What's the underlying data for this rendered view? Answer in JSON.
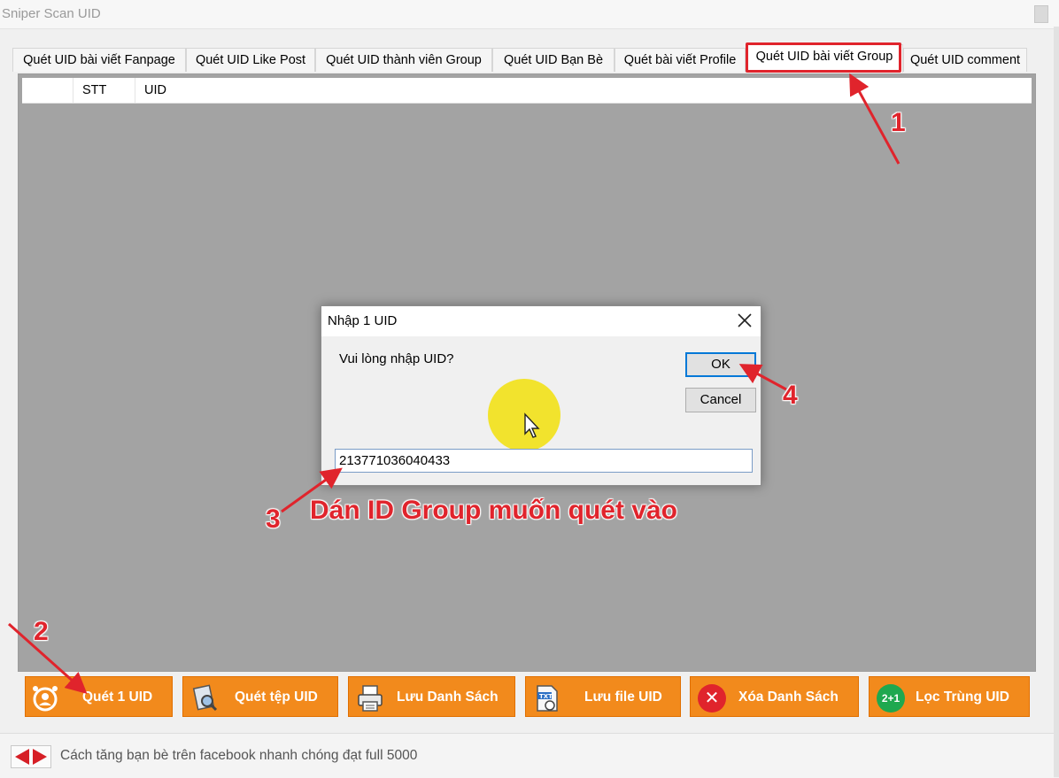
{
  "window": {
    "title": "Sniper Scan UID"
  },
  "tabs": [
    {
      "label": "Quét UID bài viết Fanpage",
      "active": false
    },
    {
      "label": "Quét UID Like Post",
      "active": false
    },
    {
      "label": "Quét UID thành viên Group",
      "active": false
    },
    {
      "label": "Quét UID Bạn Bè",
      "active": false
    },
    {
      "label": "Quét bài viết Profile",
      "active": false
    },
    {
      "label": "Quét UID bài viết Group",
      "active": true
    },
    {
      "label": "Quét UID comment",
      "active": false
    }
  ],
  "list": {
    "columns": [
      "",
      "STT",
      "UID"
    ]
  },
  "toolbar": [
    {
      "label": "Quét 1 UID",
      "icon": "alarm-user-icon"
    },
    {
      "label": "Quét tệp UID",
      "icon": "file-search-icon"
    },
    {
      "label": "Lưu Danh Sách",
      "icon": "printer-list-icon"
    },
    {
      "label": "Lưu file UID",
      "icon": "txt-file-icon"
    },
    {
      "label": "Xóa Danh Sách",
      "icon": "delete-x-icon"
    },
    {
      "label": "Lọc Trùng UID",
      "icon": "duplicate-filter-icon",
      "badge": "2+1"
    }
  ],
  "status": {
    "text": "Cách tăng bạn bè trên facebook nhanh chóng đạt full 5000"
  },
  "dialog": {
    "title": "Nhập 1 UID",
    "prompt": "Vui lòng nhập UID?",
    "ok_label": "OK",
    "cancel_label": "Cancel",
    "input_value": "213771036040433"
  },
  "annotations": {
    "step1": "1",
    "step2": "2",
    "step3": "3",
    "step4": "4",
    "caption": "Dán ID Group muốn quét vào"
  },
  "colors": {
    "accent": "#f28a1c",
    "annotation": "#e0242c",
    "list_bg": "#a3a3a3"
  }
}
